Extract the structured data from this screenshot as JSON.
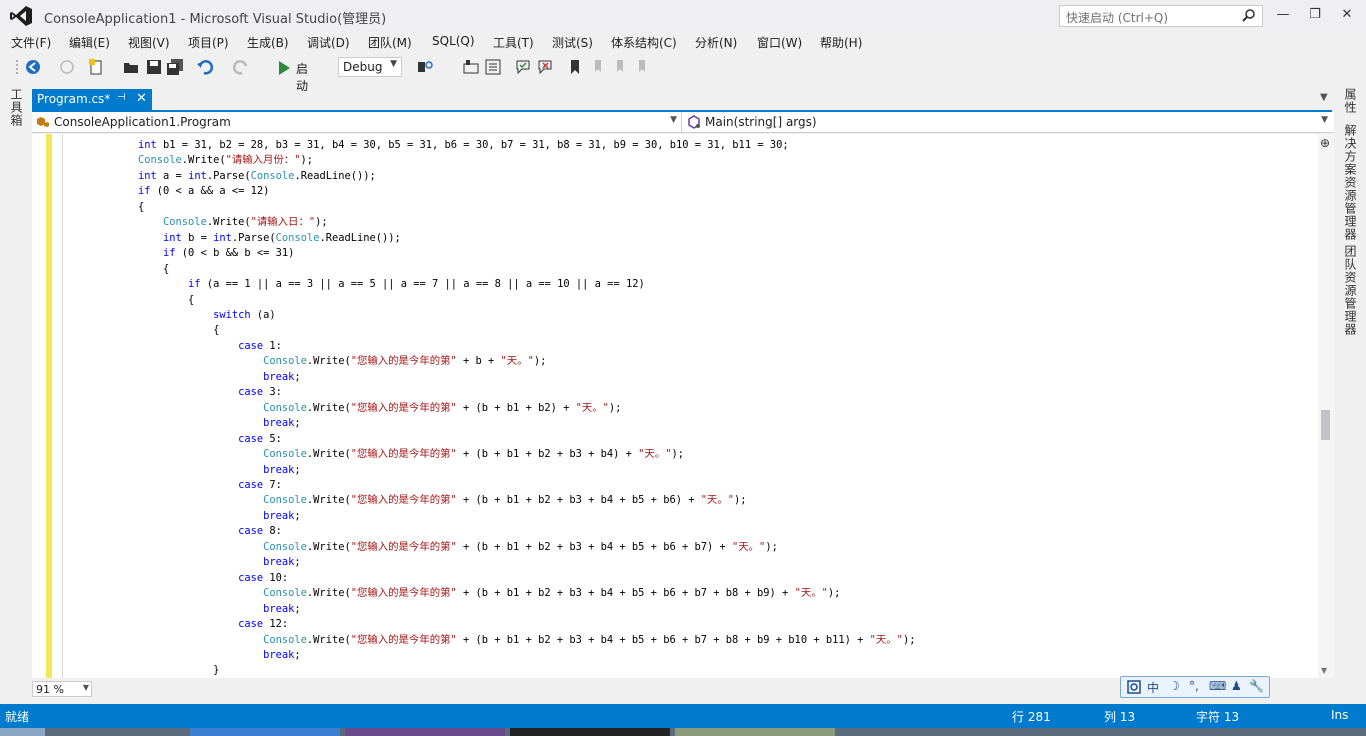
{
  "window": {
    "title": "ConsoleApplication1 - Microsoft Visual Studio(管理员)",
    "quick_launch_placeholder": "快速启动 (Ctrl+Q)",
    "minimize": "—",
    "maximize": "❐",
    "close": "✕"
  },
  "menu": [
    "文件(F)",
    "编辑(E)",
    "视图(V)",
    "项目(P)",
    "生成(B)",
    "调试(D)",
    "团队(M)",
    "SQL(Q)",
    "工具(T)",
    "测试(S)",
    "体系结构(C)",
    "分析(N)",
    "窗口(W)",
    "帮助(H)"
  ],
  "toolbar": {
    "start_label": "启动",
    "config_value": "Debug"
  },
  "side_panels": {
    "left": "工具箱",
    "right_properties": "属性",
    "right_solution": "解决方案资源管理器",
    "right_team": "团队资源管理器"
  },
  "document_tab": {
    "label": "Program.cs*",
    "pin": "⊣",
    "close": "✕"
  },
  "navbar": {
    "class_value": "ConsoleApplication1.Program",
    "member_value": "Main(string[] args)"
  },
  "code_lines": [
    [
      {
        "t": "int",
        "c": "kw"
      },
      {
        "t": " b1 = 31, b2 = 28, b3 = 31, b4 = 30, b5 = 31, b6 = 30, b7 = 31, b8 = 31, b9 = 30, b10 = 31, b11 = 30;"
      }
    ],
    [
      {
        "t": "Console",
        "c": "ty"
      },
      {
        "t": ".Write("
      },
      {
        "t": "\"请输入月份：\"",
        "c": "st"
      },
      {
        "t": ");"
      }
    ],
    [
      {
        "t": "int",
        "c": "kw"
      },
      {
        "t": " a = "
      },
      {
        "t": "int",
        "c": "kw"
      },
      {
        "t": ".Parse("
      },
      {
        "t": "Console",
        "c": "ty"
      },
      {
        "t": ".ReadLine());"
      }
    ],
    [
      {
        "t": "if",
        "c": "kw"
      },
      {
        "t": " (0 < a && a <= 12)"
      }
    ],
    [
      {
        "t": "{"
      }
    ],
    [
      {
        "t": "    "
      },
      {
        "t": "Console",
        "c": "ty"
      },
      {
        "t": ".Write("
      },
      {
        "t": "\"请输入日：\"",
        "c": "st"
      },
      {
        "t": ");"
      }
    ],
    [
      {
        "t": "    "
      },
      {
        "t": "int",
        "c": "kw"
      },
      {
        "t": " b = "
      },
      {
        "t": "int",
        "c": "kw"
      },
      {
        "t": ".Parse("
      },
      {
        "t": "Console",
        "c": "ty"
      },
      {
        "t": ".ReadLine());"
      }
    ],
    [
      {
        "t": "    "
      },
      {
        "t": "if",
        "c": "kw"
      },
      {
        "t": " (0 < b && b <= 31)"
      }
    ],
    [
      {
        "t": "    {"
      }
    ],
    [
      {
        "t": "        "
      },
      {
        "t": "if",
        "c": "kw"
      },
      {
        "t": " (a == 1 || a == 3 || a == 5 || a == 7 || a == 8 || a == 10 || a == 12)"
      }
    ],
    [
      {
        "t": "        {"
      }
    ],
    [
      {
        "t": "            "
      },
      {
        "t": "switch",
        "c": "kw"
      },
      {
        "t": " (a)"
      }
    ],
    [
      {
        "t": "            {"
      }
    ],
    [
      {
        "t": "                "
      },
      {
        "t": "case",
        "c": "kw"
      },
      {
        "t": " 1:"
      }
    ],
    [
      {
        "t": "                    "
      },
      {
        "t": "Console",
        "c": "ty"
      },
      {
        "t": ".Write("
      },
      {
        "t": "\"您输入的是今年的第\"",
        "c": "st"
      },
      {
        "t": " + b + "
      },
      {
        "t": "\"天。\"",
        "c": "st"
      },
      {
        "t": ");"
      }
    ],
    [
      {
        "t": "                    "
      },
      {
        "t": "break",
        "c": "kw"
      },
      {
        "t": ";"
      }
    ],
    [
      {
        "t": "                "
      },
      {
        "t": "case",
        "c": "kw"
      },
      {
        "t": " 3:"
      }
    ],
    [
      {
        "t": "                    "
      },
      {
        "t": "Console",
        "c": "ty"
      },
      {
        "t": ".Write("
      },
      {
        "t": "\"您输入的是今年的第\"",
        "c": "st"
      },
      {
        "t": " + (b + b1 + b2) + "
      },
      {
        "t": "\"天。\"",
        "c": "st"
      },
      {
        "t": ");"
      }
    ],
    [
      {
        "t": "                    "
      },
      {
        "t": "break",
        "c": "kw"
      },
      {
        "t": ";"
      }
    ],
    [
      {
        "t": "                "
      },
      {
        "t": "case",
        "c": "kw"
      },
      {
        "t": " 5:"
      }
    ],
    [
      {
        "t": "                    "
      },
      {
        "t": "Console",
        "c": "ty"
      },
      {
        "t": ".Write("
      },
      {
        "t": "\"您输入的是今年的第\"",
        "c": "st"
      },
      {
        "t": " + (b + b1 + b2 + b3 + b4) + "
      },
      {
        "t": "\"天。\"",
        "c": "st"
      },
      {
        "t": ");"
      }
    ],
    [
      {
        "t": "                    "
      },
      {
        "t": "break",
        "c": "kw"
      },
      {
        "t": ";"
      }
    ],
    [
      {
        "t": "                "
      },
      {
        "t": "case",
        "c": "kw"
      },
      {
        "t": " 7:"
      }
    ],
    [
      {
        "t": "                    "
      },
      {
        "t": "Console",
        "c": "ty"
      },
      {
        "t": ".Write("
      },
      {
        "t": "\"您输入的是今年的第\"",
        "c": "st"
      },
      {
        "t": " + (b + b1 + b2 + b3 + b4 + b5 + b6) + "
      },
      {
        "t": "\"天。\"",
        "c": "st"
      },
      {
        "t": ");"
      }
    ],
    [
      {
        "t": "                    "
      },
      {
        "t": "break",
        "c": "kw"
      },
      {
        "t": ";"
      }
    ],
    [
      {
        "t": "                "
      },
      {
        "t": "case",
        "c": "kw"
      },
      {
        "t": " 8:"
      }
    ],
    [
      {
        "t": "                    "
      },
      {
        "t": "Console",
        "c": "ty"
      },
      {
        "t": ".Write("
      },
      {
        "t": "\"您输入的是今年的第\"",
        "c": "st"
      },
      {
        "t": " + (b + b1 + b2 + b3 + b4 + b5 + b6 + b7) + "
      },
      {
        "t": "\"天。\"",
        "c": "st"
      },
      {
        "t": ");"
      }
    ],
    [
      {
        "t": "                    "
      },
      {
        "t": "break",
        "c": "kw"
      },
      {
        "t": ";"
      }
    ],
    [
      {
        "t": "                "
      },
      {
        "t": "case",
        "c": "kw"
      },
      {
        "t": " 10:"
      }
    ],
    [
      {
        "t": "                    "
      },
      {
        "t": "Console",
        "c": "ty"
      },
      {
        "t": ".Write("
      },
      {
        "t": "\"您输入的是今年的第\"",
        "c": "st"
      },
      {
        "t": " + (b + b1 + b2 + b3 + b4 + b5 + b6 + b7 + b8 + b9) + "
      },
      {
        "t": "\"天。\"",
        "c": "st"
      },
      {
        "t": ");"
      }
    ],
    [
      {
        "t": "                    "
      },
      {
        "t": "break",
        "c": "kw"
      },
      {
        "t": ";"
      }
    ],
    [
      {
        "t": "                "
      },
      {
        "t": "case",
        "c": "kw"
      },
      {
        "t": " 12:"
      }
    ],
    [
      {
        "t": "                    "
      },
      {
        "t": "Console",
        "c": "ty"
      },
      {
        "t": ".Write("
      },
      {
        "t": "\"您输入的是今年的第\"",
        "c": "st"
      },
      {
        "t": " + (b + b1 + b2 + b3 + b4 + b5 + b6 + b7 + b8 + b9 + b10 + b11) + "
      },
      {
        "t": "\"天。\"",
        "c": "st"
      },
      {
        "t": ");"
      }
    ],
    [
      {
        "t": "                    "
      },
      {
        "t": "break",
        "c": "kw"
      },
      {
        "t": ";"
      }
    ],
    [
      {
        "t": "            }"
      }
    ]
  ],
  "zoom": "91 %",
  "ime": [
    "中",
    "☽",
    "°,",
    "⌨",
    "♟",
    "🔧"
  ],
  "status": {
    "ready": "就绪",
    "line": "行 281",
    "col": "列 13",
    "char": "字符 13",
    "mode": "Ins"
  },
  "colors": {
    "accent": "#007acc",
    "keyword": "#0000ff",
    "type": "#2b91af",
    "string": "#a31515",
    "change_bar": "#f5e75a"
  }
}
